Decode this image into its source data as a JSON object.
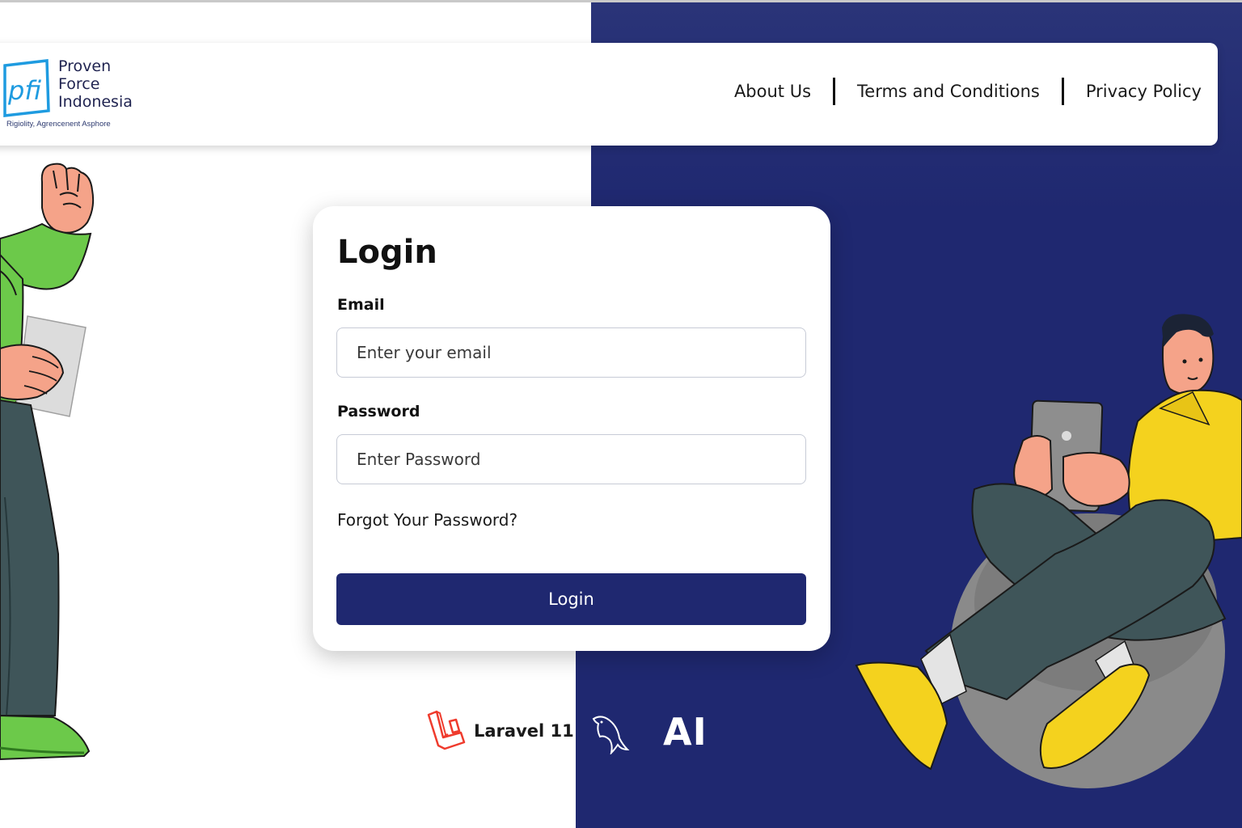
{
  "brand": {
    "logo_mark": "pfi",
    "name_lines": [
      "Proven",
      "Force",
      "Indonesia"
    ],
    "tagline": "Rigiolity, Agrencenent Asphore"
  },
  "nav": {
    "items": [
      {
        "label": "About Us"
      },
      {
        "label": "Terms and Conditions"
      },
      {
        "label": "Privacy Policy"
      }
    ]
  },
  "login": {
    "title": "Login",
    "email_label": "Email",
    "email_placeholder": "Enter your email",
    "password_label": "Password",
    "password_placeholder": "Enter Password",
    "forgot_label": "Forgot Your Password?",
    "button_label": "Login"
  },
  "tech": {
    "laravel_label": "Laravel 11",
    "ai_label": "AI"
  },
  "colors": {
    "navy": "#1f2870",
    "logo_blue": "#1e9be0",
    "laravel_red": "#ef3b2d",
    "green_shirt": "#6cc94a",
    "yellow_shirt": "#f4d21e",
    "skin": "#f5a389",
    "pants": "#3f5559"
  },
  "icons": [
    "pfi-logo-icon",
    "laravel-icon",
    "mysql-dolphin-icon",
    "ai-icon"
  ]
}
